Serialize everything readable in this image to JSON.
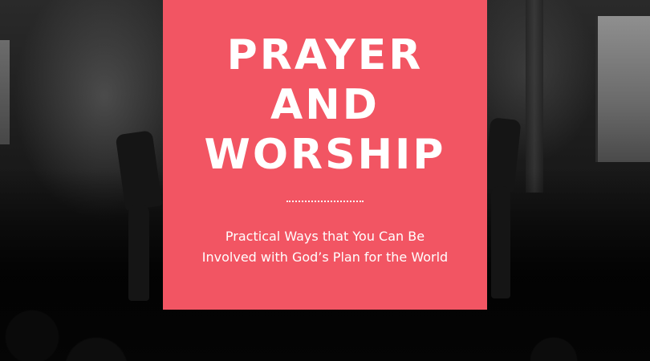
{
  "card": {
    "title_line1": "PRAYER",
    "title_line2": "AND",
    "title_line3": "WORSHIP",
    "subtitle": "Practical Ways that You Can Be Involved with God’s Plan for the World",
    "background_color": "#f25563",
    "text_color": "#ffffff"
  },
  "background": {
    "style": "black-and-white worship crowd with raised hands"
  }
}
